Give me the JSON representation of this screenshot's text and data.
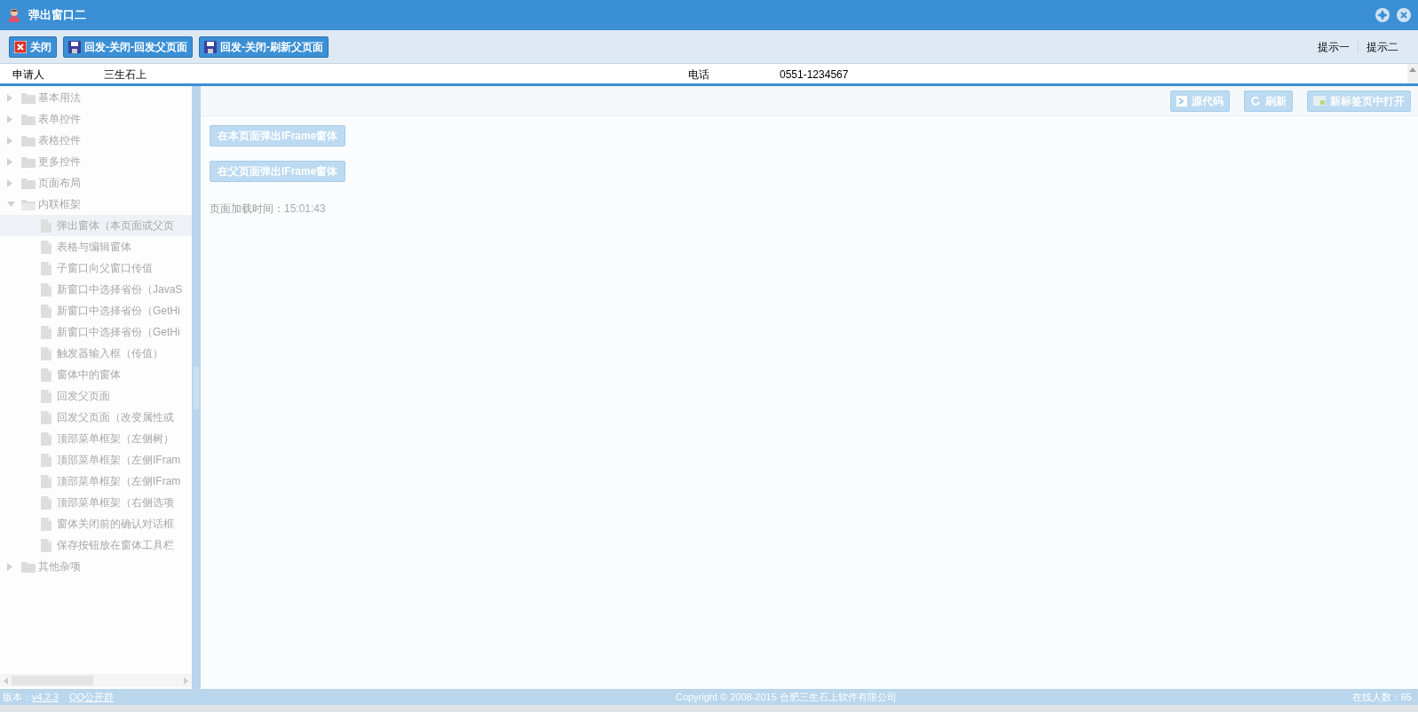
{
  "popup": {
    "title": "弹出窗口二",
    "toolbar": {
      "buttons": [
        {
          "kind": "close",
          "label": "关闭"
        },
        {
          "kind": "save",
          "label": "回发-关闭-回发父页面"
        },
        {
          "kind": "save",
          "label": "回发-关闭-刷新父页面"
        }
      ],
      "tips": [
        "提示一",
        "提示二"
      ]
    },
    "form_row": [
      "申请人",
      "三生石上",
      "电话",
      "0551-1234567"
    ]
  },
  "sidebar": {
    "tree": [
      {
        "kind": "folder",
        "label": "基本用法",
        "expanded": false
      },
      {
        "kind": "folder",
        "label": "表单控件",
        "expanded": false
      },
      {
        "kind": "folder",
        "label": "表格控件",
        "expanded": false
      },
      {
        "kind": "folder",
        "label": "更多控件",
        "expanded": false
      },
      {
        "kind": "folder",
        "label": "页面布局",
        "expanded": false
      },
      {
        "kind": "folder",
        "label": "内联框架",
        "expanded": true,
        "children": [
          {
            "kind": "leaf",
            "label": "弹出窗体（本页面或父页",
            "selected": true
          },
          {
            "kind": "leaf",
            "label": "表格与编辑窗体",
            "selected": false
          },
          {
            "kind": "leaf",
            "label": "子窗口向父窗口传值",
            "selected": false
          },
          {
            "kind": "leaf",
            "label": "新窗口中选择省份（JavaS",
            "selected": false
          },
          {
            "kind": "leaf",
            "label": "新窗口中选择省份（GetHi",
            "selected": false
          },
          {
            "kind": "leaf",
            "label": "新窗口中选择省份（GetHi",
            "selected": false
          },
          {
            "kind": "leaf",
            "label": "触发器输入框（传值）",
            "selected": false
          },
          {
            "kind": "leaf",
            "label": "窗体中的窗体",
            "selected": false
          },
          {
            "kind": "leaf",
            "label": "回发父页面",
            "selected": false
          },
          {
            "kind": "leaf",
            "label": "回发父页面（改变属性或",
            "selected": false
          },
          {
            "kind": "leaf",
            "label": "顶部菜单框架（左侧树）",
            "selected": false
          },
          {
            "kind": "leaf",
            "label": "顶部菜单框架（左侧IFram",
            "selected": false
          },
          {
            "kind": "leaf",
            "label": "顶部菜单框架（左侧IFram",
            "selected": false
          },
          {
            "kind": "leaf",
            "label": "顶部菜单框架（右侧选项",
            "selected": false
          },
          {
            "kind": "leaf",
            "label": "窗体关闭前的确认对话框",
            "selected": false
          },
          {
            "kind": "leaf",
            "label": "保存按钮放在窗体工具栏",
            "selected": false
          }
        ]
      },
      {
        "kind": "folder",
        "label": "其他杂项",
        "expanded": false
      }
    ]
  },
  "main": {
    "toolbar": [
      {
        "kind": "source",
        "label": "源代码"
      },
      {
        "kind": "refresh",
        "label": "刷新"
      },
      {
        "kind": "newtab",
        "label": "新标签页中打开"
      }
    ],
    "buttons": [
      "在本页面弹出IFrame窗体",
      "在父页面弹出IFrame窗体"
    ],
    "load_time": {
      "label": "页面加载时间：",
      "value": "15:01:43"
    }
  },
  "footer": {
    "version_label": "版本：",
    "version": "v4.2.3",
    "qq": "QQ公开群",
    "copyright": "Copyright © 2008-2015 合肥三生石上软件有限公司",
    "online_label": "在线人数：",
    "online": "65"
  }
}
